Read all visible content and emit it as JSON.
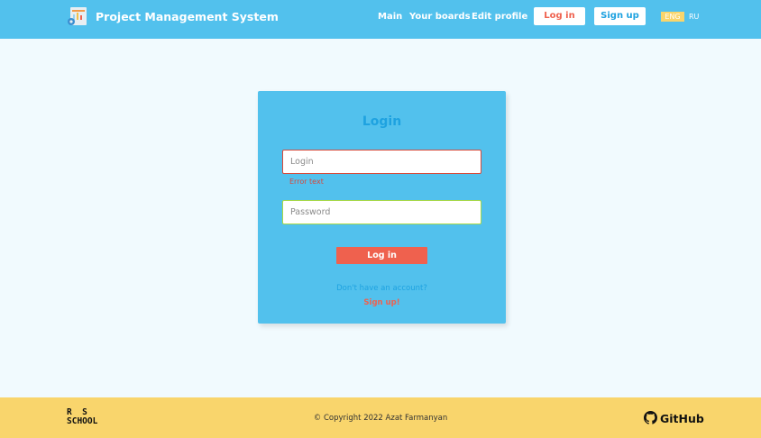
{
  "header": {
    "app_title": "Project Management System",
    "nav": {
      "main": "Main",
      "boards": "Your boards",
      "edit_profile": "Edit profile"
    },
    "login_button": "Log in",
    "signup_button": "Sign up",
    "lang_active": "ENG",
    "lang_other": "RU"
  },
  "login_form": {
    "title": "Login",
    "login_placeholder": "Login",
    "login_value": "",
    "login_error": "Error text",
    "password_placeholder": "Password",
    "password_value": "",
    "submit_label": "Log in",
    "no_account_text": "Don't have an account?",
    "signup_link": "Sign up!"
  },
  "footer": {
    "school_line1": "R  S",
    "school_line2": "SCHOOL",
    "copyright": "© Copyright 2022 Azat Farmanyan",
    "github": "GitHub"
  },
  "colors": {
    "header_bg": "#52c1ed",
    "page_bg": "#f1fafe",
    "card_bg": "#52c1ed",
    "accent_blue": "#1ea2e0",
    "accent_red": "#ef614e",
    "footer_bg": "#f9d56c",
    "error_border": "#d84a3a",
    "valid_border": "#a8d946"
  },
  "icons": {
    "logo": "project-board-logo-icon",
    "github": "github-icon"
  }
}
